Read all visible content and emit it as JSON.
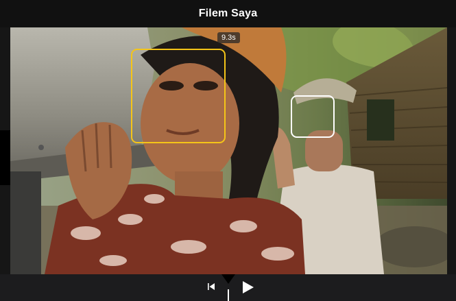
{
  "title": "Filem Saya",
  "viewer": {
    "time_badge": "9.3s"
  },
  "icons": {
    "skip_back": "skip-to-start-icon",
    "play": "play-icon"
  },
  "colors": {
    "primary_face_box": "#f5c518",
    "secondary_face_box": "#ffffff",
    "titlebar": "#111111",
    "controls_bar": "#1c1c1e"
  }
}
